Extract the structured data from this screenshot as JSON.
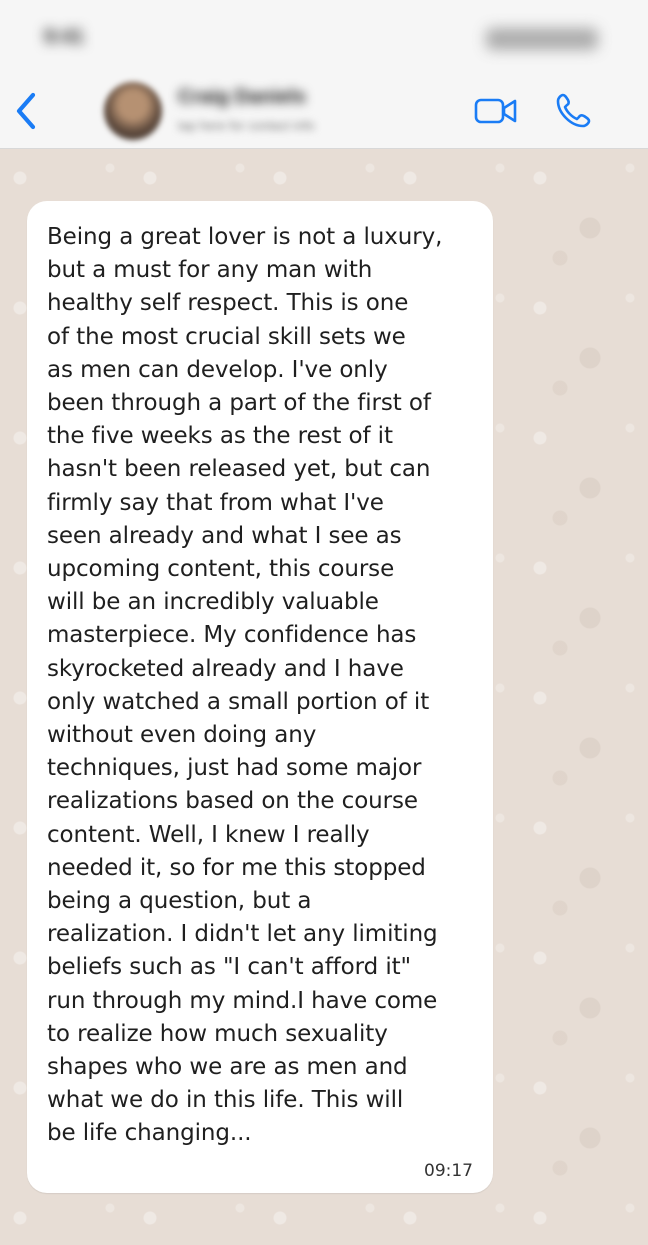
{
  "status_bar": {
    "time": "9:41"
  },
  "header": {
    "contact_name": "Craig Daniels",
    "contact_status": "tap here for contact info"
  },
  "message": {
    "lines": [
      "Being a great lover is not a luxury,",
      "but a must for any man with",
      "healthy self respect. This is one",
      "of the most crucial skill sets we",
      "as men can develop. I've only",
      "been through a part of the first of",
      "the five weeks as the rest of it",
      "hasn't been released yet, but can",
      "firmly say that from what I've",
      "seen already and what I see as",
      "upcoming content, this course",
      "will be an incredibly valuable",
      "masterpiece. My confidence has",
      "skyrocketed already and I have",
      "only watched a small portion of it",
      "without even doing any",
      "techniques, just had some major",
      "realizations based on the course",
      "content. Well, I knew I really",
      "needed it, so for me this stopped",
      "being a question, but a",
      "realization. I didn't let any limiting",
      "beliefs such as \"I can't afford it\"",
      "run through my mind.I have come",
      "to realize how much sexuality",
      "shapes who we are as men and",
      "what we do in this life. This will",
      "be life changing..."
    ],
    "time": "09:17"
  },
  "icons": {
    "back": "chevron-left-icon",
    "video": "video-camera-icon",
    "call": "phone-icon"
  },
  "colors": {
    "accent": "#1a7cf5",
    "bubble": "#ffffff",
    "chat_background": "#e7ddd5"
  }
}
